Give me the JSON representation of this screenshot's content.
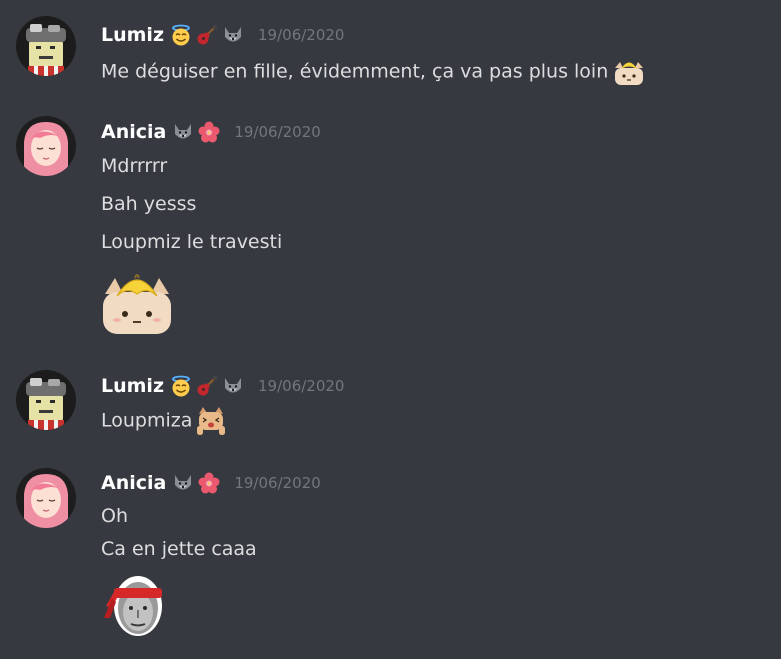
{
  "messages": [
    {
      "author": "Lumiz",
      "timestamp": "19/06/2020",
      "badges": [
        "smiling-halo-emoji",
        "guitar-emoji",
        "wolf-emoji"
      ],
      "lines": [
        "Me déguiser en fille, évidemment, ça va pas plus loin"
      ],
      "trailing_emoji": "banana-cat-emoji"
    },
    {
      "author": "Anicia",
      "timestamp": "19/06/2020",
      "badges": [
        "wolf-emoji",
        "hibiscus-emoji"
      ],
      "lines": [
        "Mdrrrrr",
        "Bah yesss",
        "Loupmiz le travesti"
      ],
      "big_emoji": "banana-cat-emoji"
    },
    {
      "author": "Lumiz",
      "timestamp": "19/06/2020",
      "badges": [
        "smiling-halo-emoji",
        "guitar-emoji",
        "wolf-emoji"
      ],
      "lines": [
        "Loupmiza"
      ],
      "trailing_emoji": "excited-cat-emoji"
    },
    {
      "author": "Anicia",
      "timestamp": "19/06/2020",
      "badges": [
        "wolf-emoji",
        "hibiscus-emoji"
      ],
      "lines": [
        "Oh",
        "Ca en jette caaa"
      ],
      "big_emoji": "headband-face-emoji"
    }
  ],
  "colors": {
    "background": "#36393f",
    "username": "#ffffff",
    "text": "#dcddde",
    "timestamp": "#72767d"
  }
}
